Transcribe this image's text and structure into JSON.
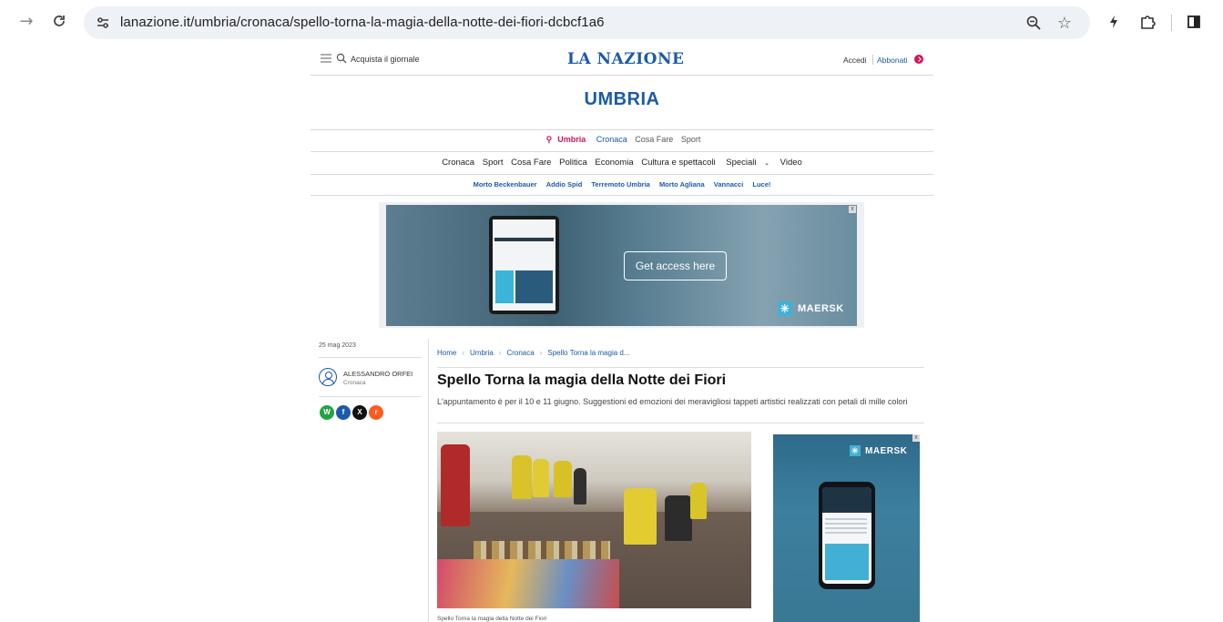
{
  "browser": {
    "url": "lanazione.it/umbria/cronaca/spello-torna-la-magia-della-notte-dei-fiori-dcbcf1a6"
  },
  "header": {
    "acquista": "Acquista il giornale",
    "logo": "LA NAZIONE",
    "accedi": "Accedi",
    "abbonati": "Abbonati"
  },
  "section": {
    "title": "UMBRIA"
  },
  "subnav": {
    "active": "Umbria",
    "items": [
      "Cronaca",
      "Cosa Fare",
      "Sport"
    ]
  },
  "mainnav": {
    "items": [
      "Cronaca",
      "Sport",
      "Cosa Fare",
      "Politica",
      "Economia",
      "Cultura e spettacoli",
      "Speciali",
      "Video"
    ]
  },
  "trends": {
    "items": [
      "Morto Beckenbauer",
      "Addio Spid",
      "Terremoto Umbria",
      "Morto Agliana",
      "Vannacci",
      "Luce!"
    ]
  },
  "ad": {
    "cta": "Get access here",
    "brand": "MAERSK",
    "close": "x"
  },
  "sidebar": {
    "date": "25 mag 2023",
    "author": "ALESSANDRO ORFEI",
    "author_section": "Cronaca",
    "share": {
      "whatsapp": "W",
      "facebook": "f",
      "x": "X",
      "reddit": "r"
    }
  },
  "breadcrumb": {
    "items": [
      "Home",
      "Umbria",
      "Cronaca",
      "Spello Torna la magia d..."
    ]
  },
  "article": {
    "title": "Spello Torna la magia della Notte dei Fiori",
    "subtitle": "L'appuntamento è per il 10 e 11 giugno. Suggestioni ed emozioni dei meravigliosi tappeti artistici realizzati con petali di mille colori",
    "photo_caption": "Spello Torna la magia della Notte dei Fiori"
  },
  "side_ad": {
    "brand": "MAERSK",
    "close": "x"
  },
  "colors": {
    "brand_blue": "#1b5aab",
    "accent_pink": "#d4145a"
  }
}
